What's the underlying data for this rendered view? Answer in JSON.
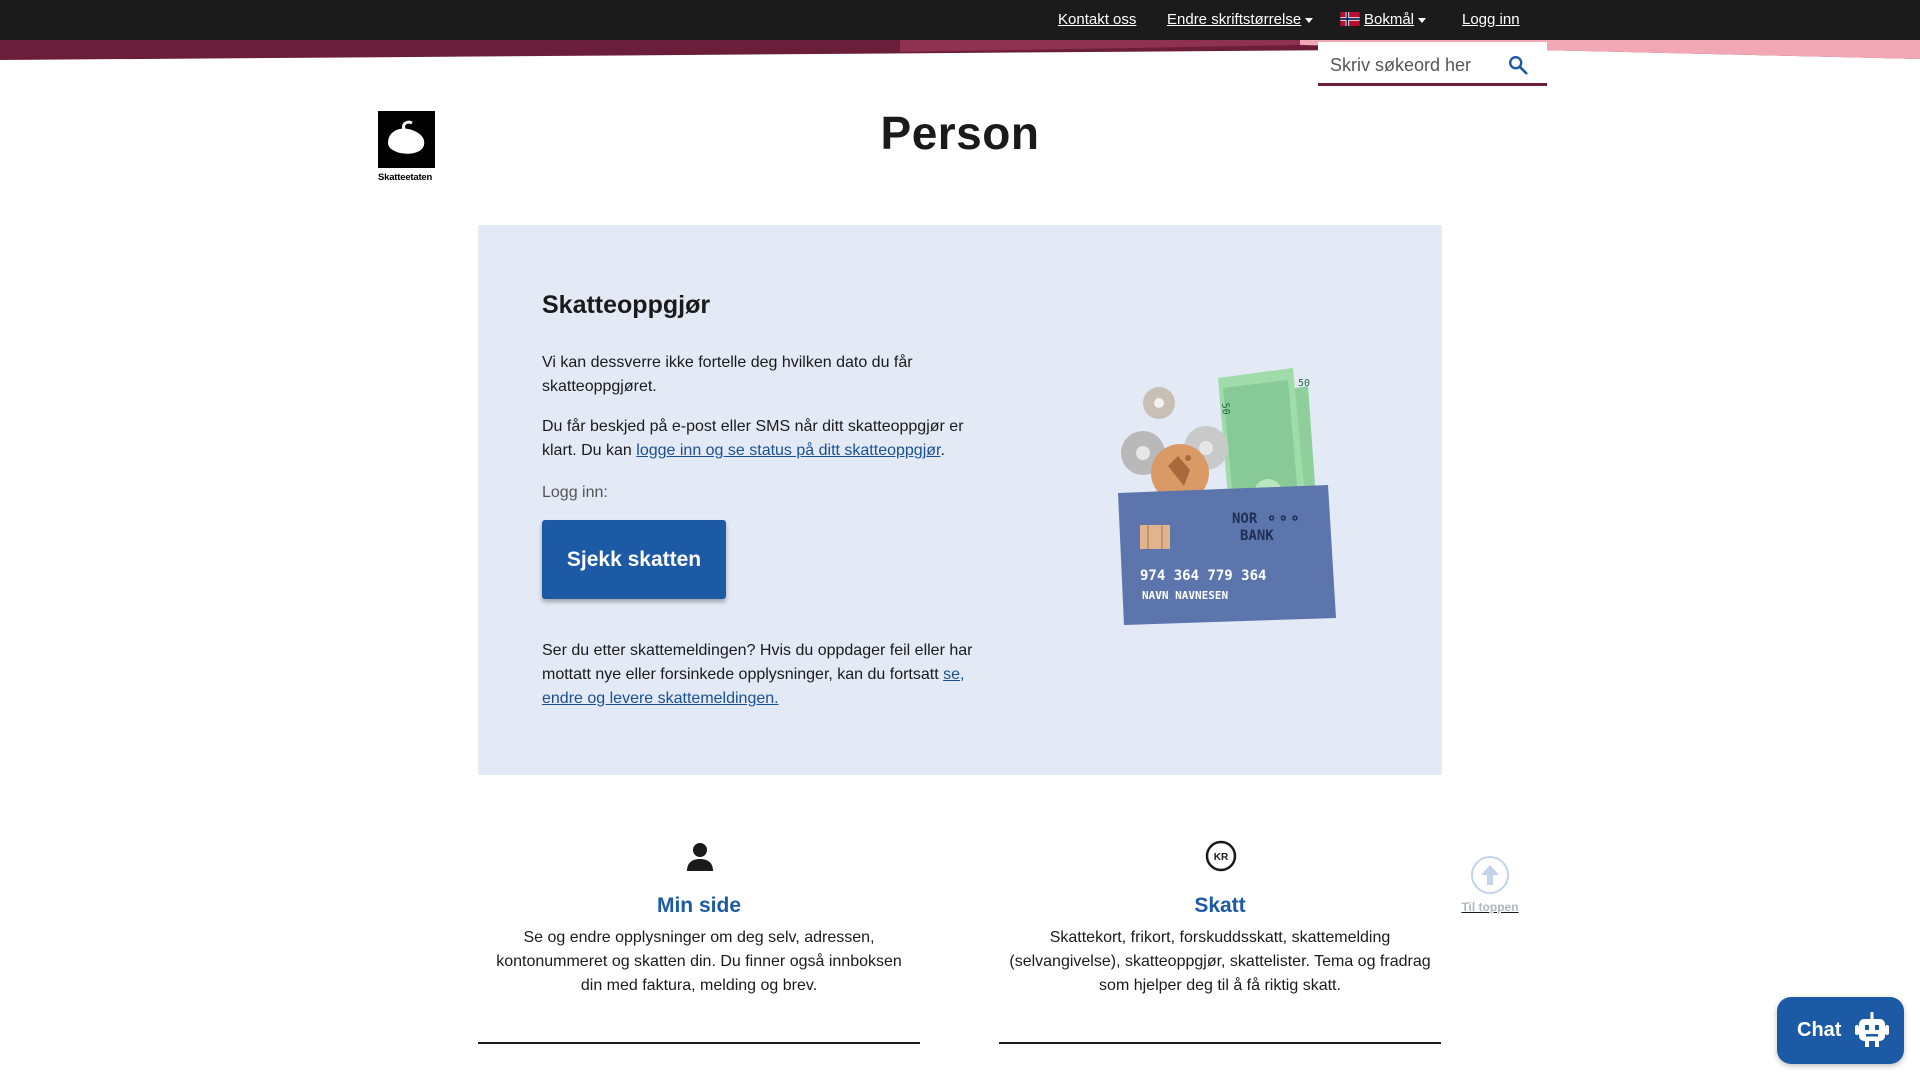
{
  "topbar": {
    "contact": "Kontakt oss",
    "fontsize": "Endre skriftstørrelse",
    "language": "Bokmål",
    "login": "Logg inn"
  },
  "search": {
    "placeholder": "Skriv søkeord her"
  },
  "logo": {
    "caption": "Skatteetaten"
  },
  "page": {
    "title": "Person"
  },
  "panel": {
    "heading": "Skatteoppgjør",
    "p1": "Vi kan dessverre ikke fortelle deg hvilken dato du får skatteoppgjøret.",
    "p2_pre": "Du får beskjed på e-post eller SMS når ditt skatteoppgjør er klart. Du kan ",
    "p2_link": "logge inn og se status på ditt skatteoppgjør",
    "p2_post": ".",
    "login_label": "Logg inn:",
    "cta": "Sjekk skatten",
    "p3_pre": "Ser du etter skattemeldingen? Hvis du oppdager feil eller har mottatt nye eller forsinkede opplysninger, kan du fortsatt ",
    "p3_link": "se, endre og levere skattemeldingen.",
    "card_bank_line1": "NOR ⚬⚬⚬",
    "card_bank_line2": "BANK",
    "card_number": "974 364 779 364",
    "card_holder": "NAVN NAVNESEN"
  },
  "cards": [
    {
      "title": "Min side",
      "text": "Se og endre opplysninger om deg selv, adressen, kontonummeret og skatten din. Du finner også innboksen din med faktura, melding og brev.",
      "icon": "person-icon"
    },
    {
      "title": "Skatt",
      "text": "Skattekort, frikort, forskuddsskatt, skattemelding (selvangivelse), skatteoppgjør, skattelister. Tema og fradrag som hjelper deg til å få riktig skatt.",
      "icon": "kr-coin-icon",
      "icon_text": "KR"
    }
  ],
  "totop": {
    "label": "Til toppen"
  },
  "chat": {
    "label": "Chat"
  },
  "colors": {
    "topbar": "#1b1b1b",
    "accent_maroon": "#6b1e3a",
    "accent_pink": "#f2a7b5",
    "primary_blue": "#1c5aa6",
    "panel_bg": "#e3eaf6"
  }
}
